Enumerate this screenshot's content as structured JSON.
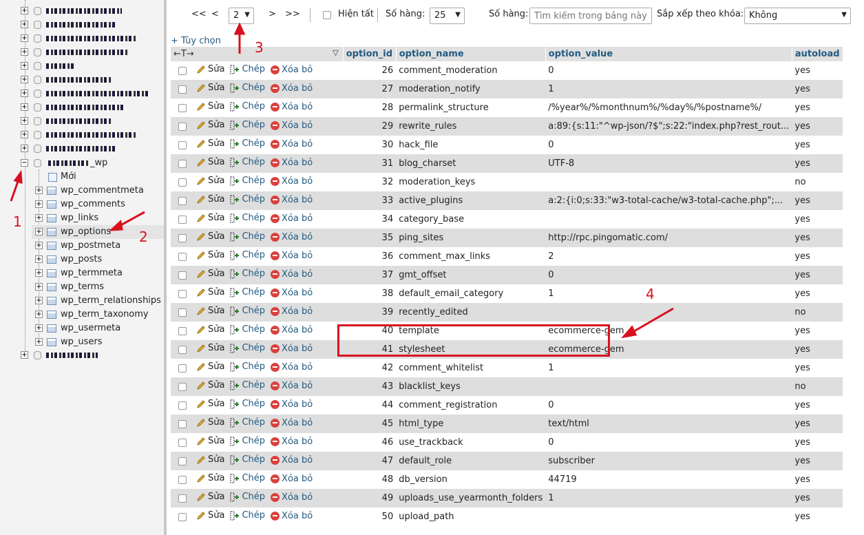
{
  "navigation": {
    "db_suffix": "_wp",
    "new_label": "Mới",
    "tables": [
      "wp_commentmeta",
      "wp_comments",
      "wp_links",
      "wp_options",
      "wp_postmeta",
      "wp_posts",
      "wp_termmeta",
      "wp_terms",
      "wp_term_relationships",
      "wp_term_taxonomy",
      "wp_usermeta",
      "wp_users"
    ],
    "selected_table": "wp_options"
  },
  "toolbar": {
    "first": "<<",
    "prev": "<",
    "page_value": "2",
    "next": ">",
    "last": ">>",
    "show_all": "Hiện tất",
    "rows_label": "Số hàng:",
    "rows_value": "25",
    "filter_label": "Số hàng:",
    "filter_placeholder": "Tìm kiếm trong bảng này",
    "sort_label": "Sắp xếp theo khóa:",
    "sort_value": "Không"
  },
  "options_link": "+ Tùy chọn",
  "col_arrows": "←T→",
  "columns": [
    "option_id",
    "option_name",
    "option_value",
    "autoload"
  ],
  "actions": {
    "edit": "Sửa",
    "copy": "Chép",
    "delete": "Xóa bỏ"
  },
  "rows": [
    [
      "26",
      "comment_moderation",
      "0",
      "yes"
    ],
    [
      "27",
      "moderation_notify",
      "1",
      "yes"
    ],
    [
      "28",
      "permalink_structure",
      "/%year%/%monthnum%/%day%/%postname%/",
      "yes"
    ],
    [
      "29",
      "rewrite_rules",
      "a:89:{s:11:\"^wp-json/?$\";s:22:\"index.php?rest_rout...",
      "yes"
    ],
    [
      "30",
      "hack_file",
      "0",
      "yes"
    ],
    [
      "31",
      "blog_charset",
      "UTF-8",
      "yes"
    ],
    [
      "32",
      "moderation_keys",
      "",
      "no"
    ],
    [
      "33",
      "active_plugins",
      "a:2:{i:0;s:33:\"w3-total-cache/w3-total-cache.php\";...",
      "yes"
    ],
    [
      "34",
      "category_base",
      "",
      "yes"
    ],
    [
      "35",
      "ping_sites",
      "http://rpc.pingomatic.com/",
      "yes"
    ],
    [
      "36",
      "comment_max_links",
      "2",
      "yes"
    ],
    [
      "37",
      "gmt_offset",
      "0",
      "yes"
    ],
    [
      "38",
      "default_email_category",
      "1",
      "yes"
    ],
    [
      "39",
      "recently_edited",
      "",
      "no"
    ],
    [
      "40",
      "template",
      "ecommerce-gem",
      "yes"
    ],
    [
      "41",
      "stylesheet",
      "ecommerce-gem",
      "yes"
    ],
    [
      "42",
      "comment_whitelist",
      "1",
      "yes"
    ],
    [
      "43",
      "blacklist_keys",
      "",
      "no"
    ],
    [
      "44",
      "comment_registration",
      "0",
      "yes"
    ],
    [
      "45",
      "html_type",
      "text/html",
      "yes"
    ],
    [
      "46",
      "use_trackback",
      "0",
      "yes"
    ],
    [
      "47",
      "default_role",
      "subscriber",
      "yes"
    ],
    [
      "48",
      "db_version",
      "44719",
      "yes"
    ],
    [
      "49",
      "uploads_use_yearmonth_folders",
      "1",
      "yes"
    ],
    [
      "50",
      "upload_path",
      "",
      "yes"
    ]
  ],
  "annotations": [
    "1",
    "2",
    "3",
    "4"
  ],
  "colors": {
    "link": "#235a81",
    "annotation": "#d8101e",
    "header_bg": "#e0e0e0",
    "even_row": "#dedede"
  }
}
